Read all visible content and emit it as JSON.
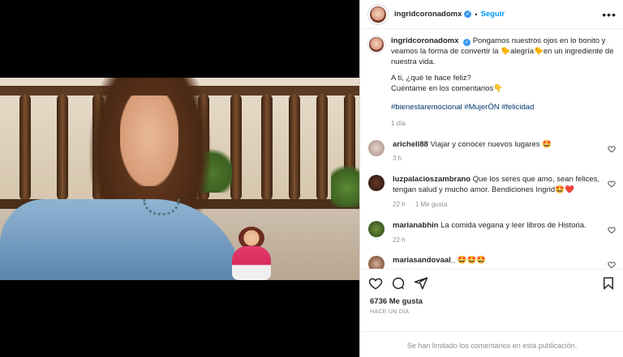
{
  "header": {
    "username": "ingridcoronadomx",
    "separator": "•",
    "follow_label": "Seguir",
    "more_label": "•••"
  },
  "caption": {
    "username": "ingridcoronadomx",
    "line1": "Pongamos nuestros ojos en lo bonito y veamos la forma de convertir la 🐤alegría🐤en un ingrediente de nuestra vida.",
    "line2": "A ti, ¿qué te hace feliz?",
    "line3": "Cuéntame en los comentarios👇",
    "hashtags": "#bienestaremocional #MujerÓN #felicidad",
    "time": "1 día"
  },
  "comments": [
    {
      "username": "aricheli88",
      "text": "Viajar y conocer nuevos lugares 🤩",
      "time": "3 h",
      "likes": ""
    },
    {
      "username": "luzpalacioszambrano",
      "text": "Que los seres que amo, sean felices, tengan salud y mucho amor. Bendiciones Ingrid🤩❤️",
      "time": "22 h",
      "likes": "1 Me gusta"
    },
    {
      "username": "marianabhin",
      "text": "La comida vegana y leer libros de Historia.",
      "time": "22 h",
      "likes": ""
    },
    {
      "username": "mariasandovaal_",
      "text": "🤩🤩🤩",
      "time": "",
      "likes": ""
    }
  ],
  "footer": {
    "likes": "6736 Me gusta",
    "ago": "HACE UN DÍA",
    "limited": "Se han limitado los comentarios en esta publicación."
  },
  "icons": {
    "like": "heart-icon",
    "comment": "comment-icon",
    "share": "paper-plane-icon",
    "save": "bookmark-icon"
  }
}
